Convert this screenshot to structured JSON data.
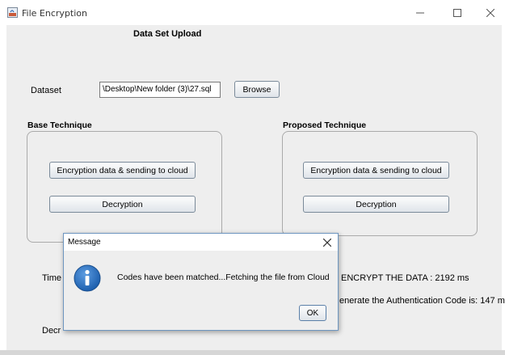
{
  "window": {
    "title": "File Encryption",
    "controls": {
      "minimize": "—",
      "maximize": "☐",
      "close": "✕"
    }
  },
  "main": {
    "heading": "Data Set Upload",
    "dataset_label": "Dataset",
    "dataset_path": "\\Desktop\\New folder (3)\\27.sql",
    "browse_button": "Browse"
  },
  "base": {
    "label": "Base Technique",
    "encrypt_button": "Encryption data & sending to cloud",
    "decrypt_button": "Decryption"
  },
  "proposed": {
    "label": "Proposed Technique",
    "encrypt_button": "Encryption data & sending to cloud",
    "decrypt_button": "Decryption"
  },
  "results": {
    "time_label_partial": "Time",
    "decr_label_partial": "Decr",
    "encrypt_time": "ENCRYPT THE DATA : 2192 ms",
    "auth_time": "enerate the Authentication Code is: 147 ms"
  },
  "dialog": {
    "title": "Message",
    "close": "✕",
    "message": "Codes have been matched...Fetching the file from Cloud",
    "ok_button": "OK",
    "icon": "info-icon"
  }
}
